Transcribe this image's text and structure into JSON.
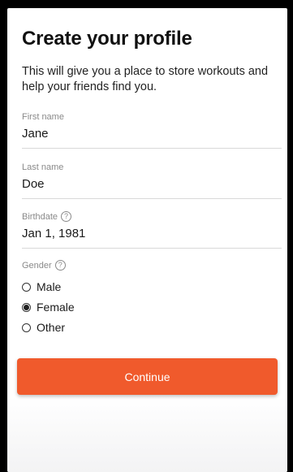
{
  "title": "Create your profile",
  "subtitle": "This will give you a place to store workouts and help your friends find you.",
  "fields": {
    "first_name": {
      "label": "First name",
      "value": "Jane"
    },
    "last_name": {
      "label": "Last name",
      "value": "Doe"
    },
    "birthdate": {
      "label": "Birthdate",
      "value": "Jan 1, 1981",
      "help": "?"
    }
  },
  "gender": {
    "label": "Gender",
    "help": "?",
    "options": [
      "Male",
      "Female",
      "Other"
    ],
    "selected": "Female"
  },
  "continue_label": "Continue",
  "colors": {
    "accent": "#f05a2c",
    "background": "#ffffff",
    "label": "#8a8a8a"
  }
}
